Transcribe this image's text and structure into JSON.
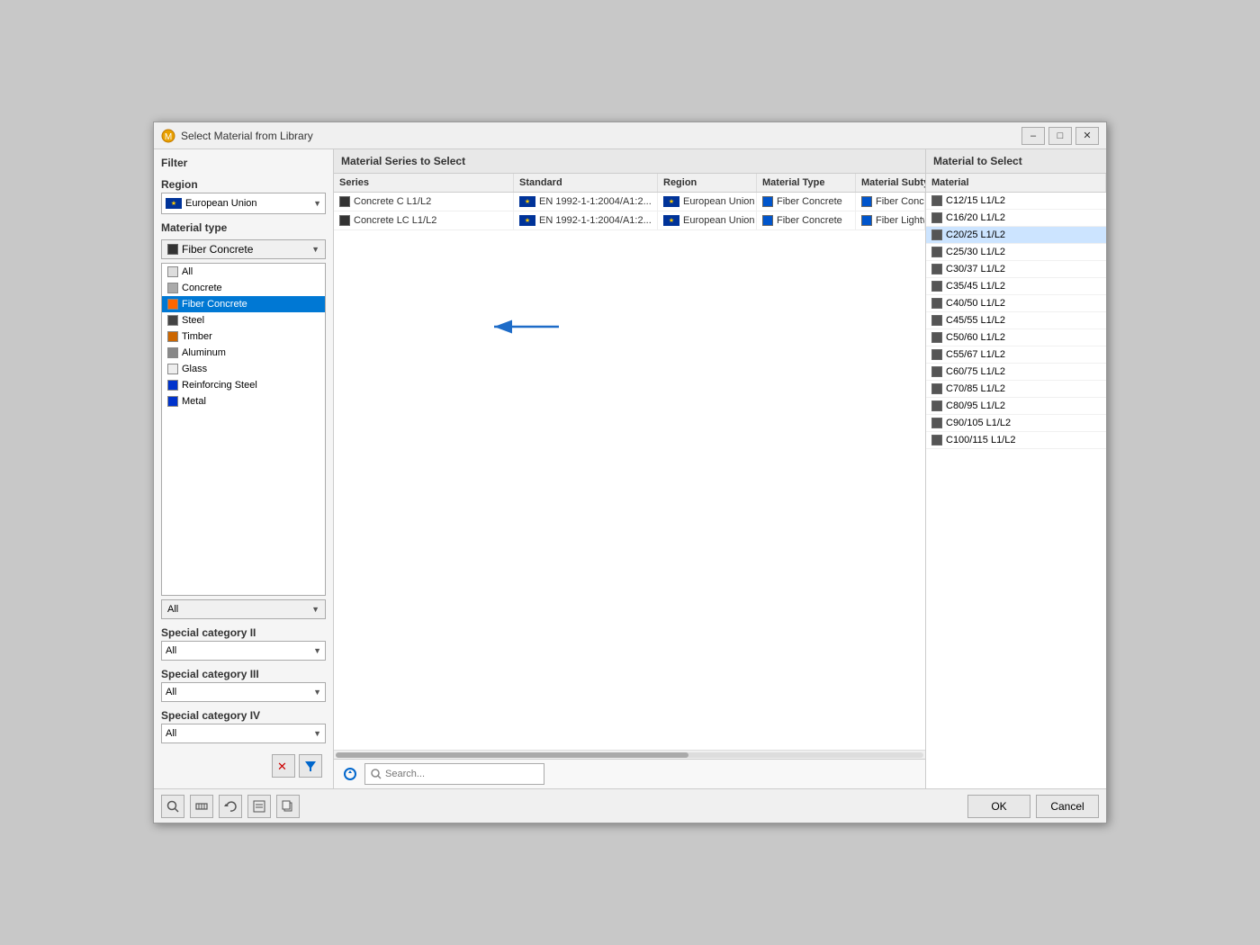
{
  "dialog": {
    "title": "Select Material from Library",
    "minimize": "–",
    "maximize": "□",
    "close": "✕"
  },
  "filter": {
    "section_title": "Filter",
    "region_label": "Region",
    "region_value": "European Union",
    "material_type_label": "Material type",
    "material_type_value": "Fiber Concrete",
    "material_types": [
      {
        "label": "Fiber Concrete",
        "color": "#333333"
      },
      {
        "label": "All",
        "color": "#dddddd"
      },
      {
        "label": "Concrete",
        "color": "#aaaaaa"
      },
      {
        "label": "Fiber Concrete",
        "color": "#0066cc",
        "selected": true
      },
      {
        "label": "Steel",
        "color": "#444444"
      },
      {
        "label": "Timber",
        "color": "#cc6600"
      },
      {
        "label": "Aluminum",
        "color": "#888888"
      },
      {
        "label": "Glass",
        "color": "#eeeeee"
      },
      {
        "label": "Reinforcing Steel",
        "color": "#0033cc"
      },
      {
        "label": "Metal",
        "color": "#0033cc"
      }
    ],
    "special_cat_1_label": "All",
    "special_cat_2_label": "All",
    "special_cat_3_label": "All",
    "special_cat_4_label": "All",
    "special_category_ii": "Special category II",
    "special_category_iii": "Special category III",
    "special_category_iv": "Special category IV"
  },
  "series_panel": {
    "header": "Material Series to Select",
    "columns": [
      "Series",
      "Standard",
      "Region",
      "Material Type",
      "Material Subtype"
    ],
    "rows": [
      {
        "series": "Concrete C L1/L2",
        "series_color": "#333333",
        "standard": "EN 1992-1-1:2004/A1:2...",
        "region": "European Union",
        "material_type": "Fiber Concrete",
        "material_type_color": "#0055cc",
        "material_subtype": "Fiber Concrete",
        "material_subtype_color": "#0055cc"
      },
      {
        "series": "Concrete LC L1/L2",
        "series_color": "#333333",
        "standard": "EN 1992-1-1:2004/A1:2...",
        "region": "European Union",
        "material_type": "Fiber Concrete",
        "material_type_color": "#0055cc",
        "material_subtype": "Fiber Lightweigh...",
        "material_subtype_color": "#0055cc"
      }
    ]
  },
  "material_select_panel": {
    "header": "Material to Select",
    "material_column": "Material",
    "materials": [
      {
        "label": "C12/15 L1/L2",
        "color": "#555555"
      },
      {
        "label": "C16/20 L1/L2",
        "color": "#555555"
      },
      {
        "label": "C20/25 L1/L2",
        "color": "#555555",
        "selected": true
      },
      {
        "label": "C25/30 L1/L2",
        "color": "#555555"
      },
      {
        "label": "C30/37 L1/L2",
        "color": "#555555"
      },
      {
        "label": "C35/45 L1/L2",
        "color": "#555555"
      },
      {
        "label": "C40/50 L1/L2",
        "color": "#555555"
      },
      {
        "label": "C45/55 L1/L2",
        "color": "#555555"
      },
      {
        "label": "C50/60 L1/L2",
        "color": "#555555"
      },
      {
        "label": "C55/67 L1/L2",
        "color": "#555555"
      },
      {
        "label": "C60/75 L1/L2",
        "color": "#555555"
      },
      {
        "label": "C70/85 L1/L2",
        "color": "#555555"
      },
      {
        "label": "C80/95 L1/L2",
        "color": "#555555"
      },
      {
        "label": "C90/105 L1/L2",
        "color": "#555555"
      },
      {
        "label": "C100/115 L1/L2",
        "color": "#555555"
      }
    ]
  },
  "bottom": {
    "search_placeholder": "Search...",
    "ok_label": "OK",
    "cancel_label": "Cancel"
  },
  "footer_icons": [
    "🔍",
    "📊",
    "↩",
    "📋",
    "📄"
  ]
}
